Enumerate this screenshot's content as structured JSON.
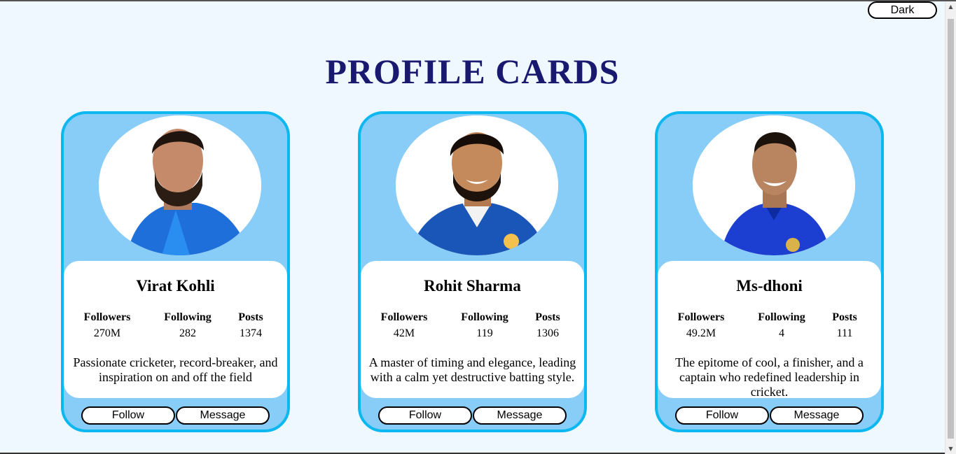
{
  "theme_toggle": {
    "label": "Dark"
  },
  "page": {
    "title": "PROFILE CARDS"
  },
  "cards": [
    {
      "name": "Virat Kohli",
      "stats": [
        {
          "label": "Followers",
          "value": "270M"
        },
        {
          "label": "Following",
          "value": "282"
        },
        {
          "label": "Posts",
          "value": "1374"
        }
      ],
      "bio": "Passionate cricketer, record-breaker, and inspiration on and off the field",
      "follow_label": "Follow",
      "message_label": "Message"
    },
    {
      "name": "Rohit Sharma",
      "stats": [
        {
          "label": "Followers",
          "value": "42M"
        },
        {
          "label": "Following",
          "value": "119"
        },
        {
          "label": "Posts",
          "value": "1306"
        }
      ],
      "bio": "A master of timing and elegance, leading with a calm yet destructive batting style.",
      "follow_label": "Follow",
      "message_label": "Message"
    },
    {
      "name": "Ms-dhoni",
      "stats": [
        {
          "label": "Followers",
          "value": "49.2M"
        },
        {
          "label": "Following",
          "value": "4"
        },
        {
          "label": "Posts",
          "value": "111"
        }
      ],
      "bio": "The epitome of cool, a finisher, and a captain who redefined leadership in cricket.",
      "follow_label": "Follow",
      "message_label": "Message"
    }
  ],
  "colors": {
    "background": "#eff8ff",
    "title": "#191970",
    "card_fill": "#88cdf8",
    "card_border": "#0cb8ef"
  }
}
